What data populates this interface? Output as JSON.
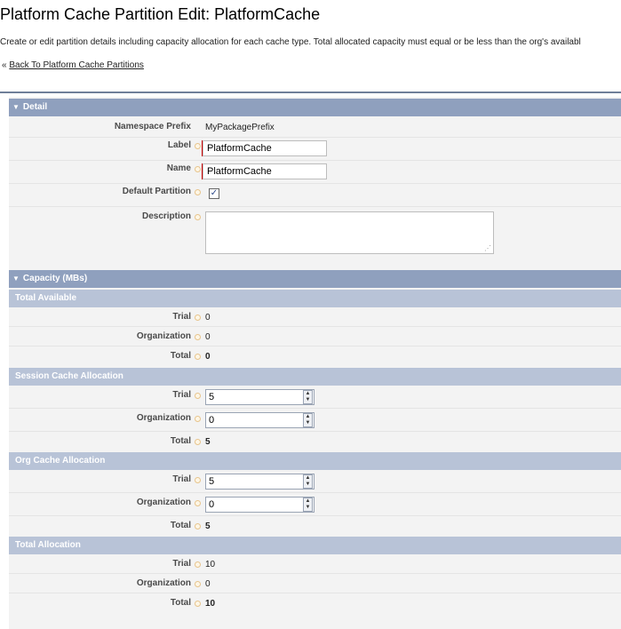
{
  "header": {
    "title": "Platform Cache Partition Edit: PlatformCache",
    "description": "Create or edit partition details including capacity allocation for each cache type. Total allocated capacity must equal or be less than the org's availabl",
    "back_prefix": "«",
    "back_link": "Back To Platform Cache Partitions"
  },
  "detail": {
    "title": "Detail",
    "namespace_label": "Namespace Prefix",
    "namespace_value": "MyPackagePrefix",
    "label_label": "Label",
    "label_value": "PlatformCache",
    "name_label": "Name",
    "name_value": "PlatformCache",
    "default_label": "Default Partition",
    "default_checked": "✓",
    "description_label": "Description",
    "description_value": ""
  },
  "capacity": {
    "title": "Capacity (MBs)",
    "total_available": {
      "title": "Total Available",
      "trial_label": "Trial",
      "trial": "0",
      "org_label": "Organization",
      "org": "0",
      "total_label": "Total",
      "total": "0"
    },
    "session": {
      "title": "Session Cache Allocation",
      "trial_label": "Trial",
      "trial": "5",
      "org_label": "Organization",
      "org": "0",
      "total_label": "Total",
      "total": "5"
    },
    "orgcache": {
      "title": "Org Cache Allocation",
      "trial_label": "Trial",
      "trial": "5",
      "org_label": "Organization",
      "org": "0",
      "total_label": "Total",
      "total": "5"
    },
    "total_allocation": {
      "title": "Total Allocation",
      "trial_label": "Trial",
      "trial": "10",
      "org_label": "Organization",
      "org": "0",
      "total_label": "Total",
      "total": "10"
    }
  }
}
